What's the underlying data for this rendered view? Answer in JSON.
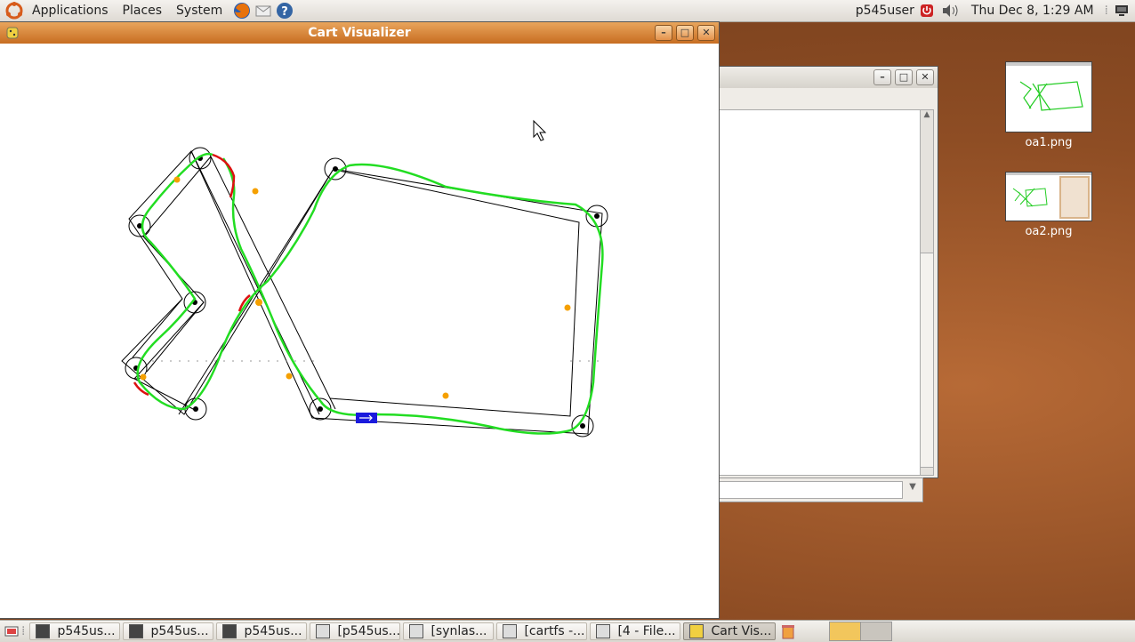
{
  "top_panel": {
    "menus": [
      "Applications",
      "Places",
      "System"
    ],
    "user": "p545user",
    "clock": "Thu Dec  8,  1:29 AM",
    "launchers": [
      "firefox-icon",
      "mail-icon",
      "help-icon"
    ]
  },
  "main_window": {
    "title": "Cart Visualizer"
  },
  "desktop": {
    "icons": [
      {
        "label": "oa1.png"
      },
      {
        "label": "oa2.png"
      }
    ]
  },
  "taskbar": {
    "items": [
      {
        "label": "p545us...",
        "icon": "terminal-icon"
      },
      {
        "label": "p545us...",
        "icon": "terminal-icon"
      },
      {
        "label": "p545us...",
        "icon": "terminal-icon"
      },
      {
        "label": "[p545us...",
        "icon": "terminal-icon"
      },
      {
        "label": "[synlas...",
        "icon": "text-editor-icon"
      },
      {
        "label": "[cartfs -...",
        "icon": "file-icon"
      },
      {
        "label": "[4 - File...",
        "icon": "file-icon"
      },
      {
        "label": "Cart Vis...",
        "icon": "python-icon",
        "active": true
      }
    ]
  },
  "colors": {
    "track_outline": "#000000",
    "path_green": "#22dd22",
    "path_red": "#dd1111",
    "obstacle_orange": "#f5a000",
    "cart_blue": "#1a1add",
    "waypoint_black": "#000000"
  }
}
